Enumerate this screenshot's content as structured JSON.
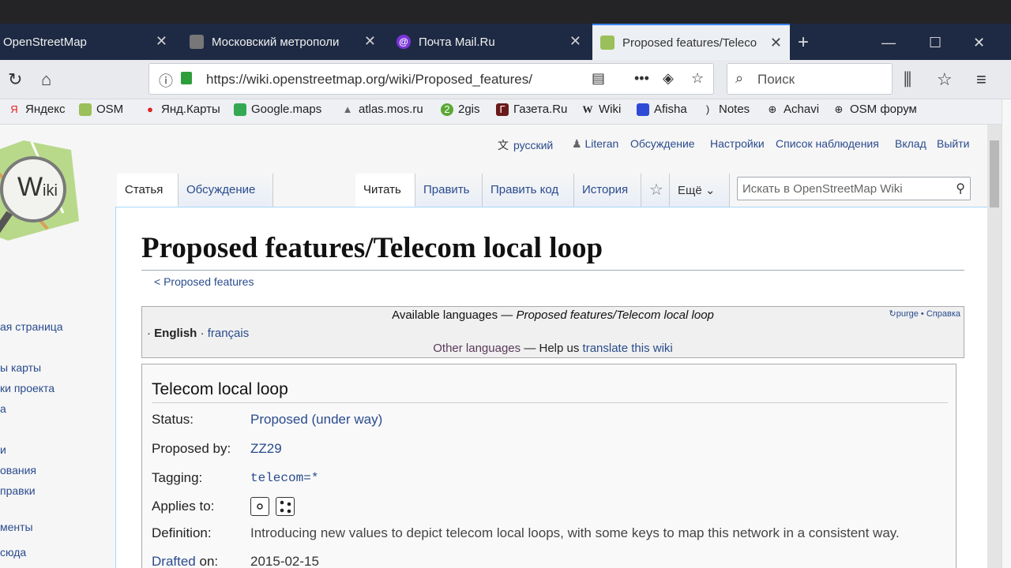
{
  "tabs": [
    {
      "label": "OpenStreetMap",
      "icon": "osm-icon"
    },
    {
      "label": "Московский метрополи",
      "icon": "metro-icon"
    },
    {
      "label": "Почта Mail.Ru",
      "icon": "mail-icon"
    },
    {
      "label": "Proposed features/Teleco",
      "icon": "wiki-icon",
      "active": true
    }
  ],
  "url": "https://wiki.openstreetmap.org/wiki/Proposed_features/",
  "browser_search_placeholder": "Поиск",
  "bookmarks": [
    "Яндекс",
    "OSM",
    "Янд.Карты",
    "Google.maps",
    "atlas.mos.ru",
    "2gis",
    "Газета.Ru",
    "Wiki",
    "Afisha",
    "Notes",
    "Achavi",
    "OSM форум"
  ],
  "personal": {
    "language": "русский",
    "user": "Literan",
    "talk": "Обсуждение",
    "settings": "Настройки",
    "watchlist": "Список наблюдения",
    "contributions": "Вклад",
    "logout": "Выйти"
  },
  "namespaces": {
    "article": "Статья",
    "discussion": "Обсуждение"
  },
  "views": {
    "read": "Читать",
    "edit": "Править",
    "edit_source": "Править код",
    "history": "История",
    "more": "Ещё"
  },
  "wiki_search_placeholder": "Искать в OpenStreetMap Wiki",
  "sidebar": [
    "ая страница",
    "ы карты",
    "ки проекта",
    "а",
    "и",
    "ования",
    "правки",
    "менты",
    "сюда"
  ],
  "page_title": "Proposed features/Telecom local loop",
  "subpage_link": "< Proposed features",
  "languages": {
    "title_prefix": "Available languages — ",
    "title_page": "Proposed features/Telecom local loop",
    "purge": "purge",
    "help": "Справка",
    "current": "English",
    "other": "français",
    "other_languages": "Other languages",
    "help_us": " — Help us ",
    "translate": "translate this wiki"
  },
  "infobox": {
    "title": "Telecom local loop",
    "status_label": "Status:",
    "status_value": "Proposed",
    "status_detail": "(under way)",
    "proposed_by_label": "Proposed by:",
    "proposed_by_value": "ZZ29",
    "tagging_label": "Tagging:",
    "tagging_value": "telecom=*",
    "applies_to_label": "Applies to:",
    "definition_label": "Definition:",
    "definition_value": "Introducing new values to depict telecom local loops, with some keys to map this network in a consistent way.",
    "drafted_label": "Drafted",
    "drafted_suffix": "on:",
    "drafted_value": "2015-02-15"
  },
  "colors": {
    "link": "#2a4b8d",
    "tabstrip": "#1e2a44",
    "border": "#a7d7f9"
  }
}
